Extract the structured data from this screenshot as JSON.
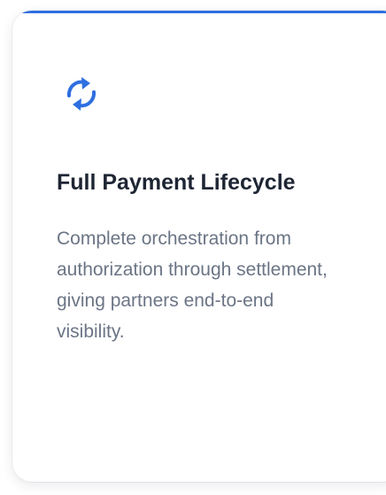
{
  "card": {
    "title": "Full Payment Lifecycle",
    "description": "Complete orchestration from authorization through settlement, giving partners end-to-end visibility.",
    "icon": "refresh-icon"
  },
  "colors": {
    "accent": "#2f6fe0",
    "title": "#1e2533",
    "description": "#6b7585"
  }
}
